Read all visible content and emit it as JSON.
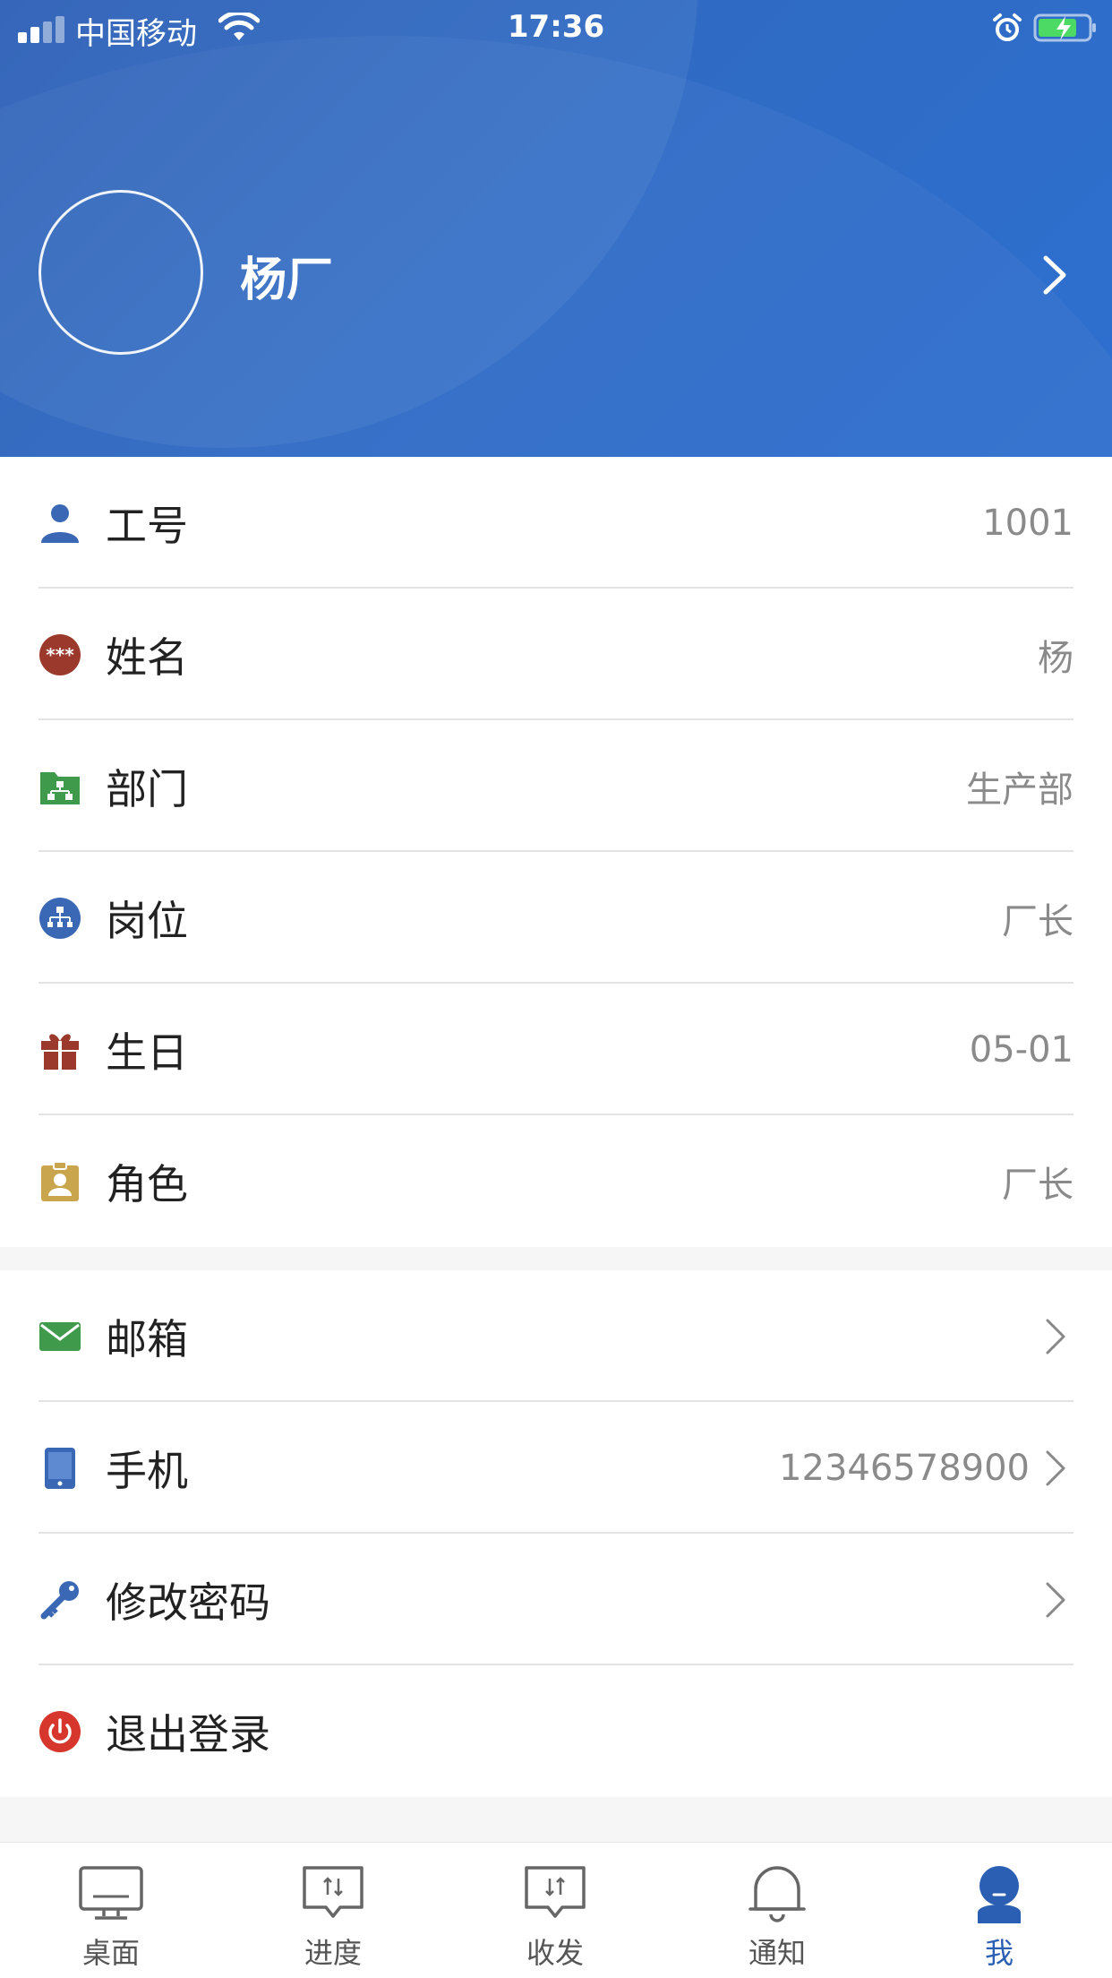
{
  "status_bar": {
    "carrier": "中国移动",
    "time": "17:36"
  },
  "profile": {
    "name": "杨厂"
  },
  "info_rows": [
    {
      "icon": "person-icon",
      "label": "工号",
      "value": "1001",
      "color": "#3a68b4"
    },
    {
      "icon": "name-badge-icon",
      "label": "姓名",
      "value": "杨",
      "color": "#9b3a2c"
    },
    {
      "icon": "department-folder-icon",
      "label": "部门",
      "value": "生产部",
      "color": "#3f9a4b"
    },
    {
      "icon": "org-chart-icon",
      "label": "岗位",
      "value": "厂长",
      "color": "#3a68b4"
    },
    {
      "icon": "gift-icon",
      "label": "生日",
      "value": "05-01",
      "color": "#9b3a2c"
    },
    {
      "icon": "role-badge-icon",
      "label": "角色",
      "value": "厂长",
      "color": "#c9a64e"
    }
  ],
  "action_rows": [
    {
      "icon": "mail-icon",
      "label": "邮箱",
      "value": "",
      "color": "#3f9a4b"
    },
    {
      "icon": "phone-icon",
      "label": "手机",
      "value": "12346578900",
      "color": "#3a68b4"
    },
    {
      "icon": "key-icon",
      "label": "修改密码",
      "value": "",
      "color": "#3a68b4"
    },
    {
      "icon": "power-icon",
      "label": "退出登录",
      "value": "",
      "color": "#d6362b"
    }
  ],
  "tabs": [
    {
      "icon": "desktop-icon",
      "label": "桌面",
      "active": false
    },
    {
      "icon": "progress-icon",
      "label": "进度",
      "active": false
    },
    {
      "icon": "send-receive-icon",
      "label": "收发",
      "active": false
    },
    {
      "icon": "bell-icon",
      "label": "通知",
      "active": false
    },
    {
      "icon": "me-icon",
      "label": "我",
      "active": true
    }
  ],
  "colors": {
    "header_blue": "#2f6bc4",
    "active_tab": "#2b5fb3",
    "battery_green": "#4cd964"
  }
}
